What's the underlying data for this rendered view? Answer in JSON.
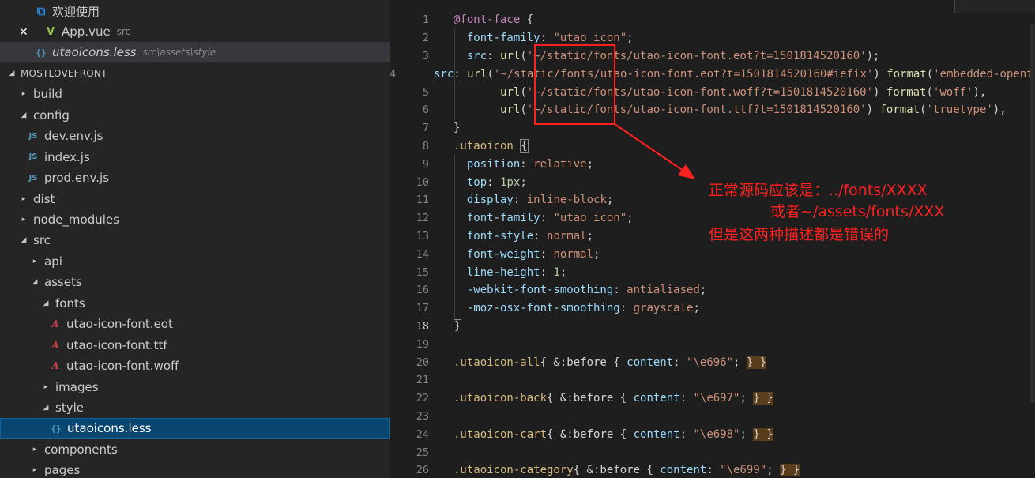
{
  "open_editors": [
    {
      "icon": "vscode-icon",
      "label": "欢迎使用",
      "description": "",
      "italic": false
    },
    {
      "icon": "vue-icon",
      "label": "App.vue",
      "description": "src",
      "italic": false,
      "dirty": true
    },
    {
      "icon": "less-icon",
      "label": "utaoicons.less",
      "description": "src\\assets\\style",
      "italic": true
    }
  ],
  "explorer": {
    "title": "MOSTLOVEFRONT",
    "items": [
      {
        "label": "build",
        "type": "folder",
        "expanded": false,
        "depth": 0
      },
      {
        "label": "config",
        "type": "folder",
        "expanded": true,
        "depth": 0
      },
      {
        "label": "dev.env.js",
        "type": "js",
        "depth": 1
      },
      {
        "label": "index.js",
        "type": "js",
        "depth": 1
      },
      {
        "label": "prod.env.js",
        "type": "js",
        "depth": 1
      },
      {
        "label": "dist",
        "type": "folder",
        "expanded": false,
        "depth": 0
      },
      {
        "label": "node_modules",
        "type": "folder",
        "expanded": false,
        "depth": 0
      },
      {
        "label": "src",
        "type": "folder",
        "expanded": true,
        "depth": 0
      },
      {
        "label": "api",
        "type": "folder",
        "expanded": false,
        "depth": 1
      },
      {
        "label": "assets",
        "type": "folder",
        "expanded": true,
        "depth": 1
      },
      {
        "label": "fonts",
        "type": "folder",
        "expanded": true,
        "depth": 2
      },
      {
        "label": "utao-icon-font.eot",
        "type": "font",
        "depth": 3
      },
      {
        "label": "utao-icon-font.ttf",
        "type": "font",
        "depth": 3
      },
      {
        "label": "utao-icon-font.woff",
        "type": "font",
        "depth": 3
      },
      {
        "label": "images",
        "type": "folder",
        "expanded": false,
        "depth": 2
      },
      {
        "label": "style",
        "type": "folder",
        "expanded": true,
        "depth": 2
      },
      {
        "label": "utaoicons.less",
        "type": "less",
        "depth": 3,
        "selected": true
      },
      {
        "label": "components",
        "type": "folder",
        "expanded": false,
        "depth": 1
      },
      {
        "label": "pages",
        "type": "folder",
        "expanded": false,
        "depth": 1
      }
    ]
  },
  "icons": {
    "twistie_collapsed": "▸",
    "twistie_expanded": "◢",
    "js": "JS",
    "font": "A",
    "less": "{}",
    "vue": "V",
    "close": "✕"
  },
  "editor": {
    "line_numbers": [
      "1",
      "2",
      "3",
      "4",
      "5",
      "6",
      "7",
      "8",
      "9",
      "10",
      "11",
      "12",
      "13",
      "14",
      "15",
      "16",
      "17",
      "18",
      "19",
      "20",
      "21",
      "22",
      "23",
      "24",
      "25",
      "26"
    ],
    "current_line": "18",
    "lines": [
      [
        [
          "t-at",
          "@font-face"
        ],
        [
          "code",
          " {"
        ]
      ],
      [
        [
          "code",
          "  "
        ],
        [
          "t-prop",
          "font-family"
        ],
        [
          "code",
          ": "
        ],
        [
          "t-str",
          "\"utao icon\""
        ],
        [
          "code",
          ";"
        ]
      ],
      [
        [
          "code",
          "  "
        ],
        [
          "t-prop",
          "src"
        ],
        [
          "code",
          ": "
        ],
        [
          "t-fn",
          "url"
        ],
        [
          "code",
          "("
        ],
        [
          "t-str",
          "'~/static/fonts/utao-icon-font.eot?t=1501814520160'"
        ],
        [
          "code",
          ");"
        ]
      ],
      [
        [
          "code",
          "  "
        ],
        [
          "t-prop",
          "src"
        ],
        [
          "code",
          ": "
        ],
        [
          "t-fn",
          "url"
        ],
        [
          "code",
          "("
        ],
        [
          "t-str",
          "'~/static/fonts/utao-icon-font.eot?t=1501814520160#iefix'"
        ],
        [
          "code",
          ") "
        ],
        [
          "t-fn",
          "format"
        ],
        [
          "code",
          "("
        ],
        [
          "t-str",
          "'embedded-opentype'"
        ],
        [
          "code",
          "),"
        ]
      ],
      [
        [
          "code",
          "       "
        ],
        [
          "t-fn",
          "url"
        ],
        [
          "code",
          "("
        ],
        [
          "t-str",
          "'~/static/fonts/utao-icon-font.woff?t=1501814520160'"
        ],
        [
          "code",
          ") "
        ],
        [
          "t-fn",
          "format"
        ],
        [
          "code",
          "("
        ],
        [
          "t-str",
          "'woff'"
        ],
        [
          "code",
          "),"
        ]
      ],
      [
        [
          "code",
          "       "
        ],
        [
          "t-fn",
          "url"
        ],
        [
          "code",
          "("
        ],
        [
          "t-str",
          "'~/static/fonts/utao-icon-font.ttf?t=1501814520160'"
        ],
        [
          "code",
          ") "
        ],
        [
          "t-fn",
          "format"
        ],
        [
          "code",
          "("
        ],
        [
          "t-str",
          "'truetype'"
        ],
        [
          "code",
          "),"
        ]
      ],
      [
        [
          "code",
          "}"
        ]
      ],
      [
        [
          "t-sel",
          ".utaoicon"
        ],
        [
          "code",
          " "
        ],
        [
          "t-brk2",
          "{"
        ]
      ],
      [
        [
          "code",
          "  "
        ],
        [
          "t-prop",
          "position"
        ],
        [
          "code",
          ": "
        ],
        [
          "t-str",
          "relative"
        ],
        [
          "code",
          ";"
        ]
      ],
      [
        [
          "code",
          "  "
        ],
        [
          "t-prop",
          "top"
        ],
        [
          "code",
          ": "
        ],
        [
          "t-num",
          "1px"
        ],
        [
          "code",
          ";"
        ]
      ],
      [
        [
          "code",
          "  "
        ],
        [
          "t-prop",
          "display"
        ],
        [
          "code",
          ": "
        ],
        [
          "t-str",
          "inline-block"
        ],
        [
          "code",
          ";"
        ]
      ],
      [
        [
          "code",
          "  "
        ],
        [
          "t-prop",
          "font-family"
        ],
        [
          "code",
          ": "
        ],
        [
          "t-str",
          "\"utao icon\""
        ],
        [
          "code",
          ";"
        ]
      ],
      [
        [
          "code",
          "  "
        ],
        [
          "t-prop",
          "font-style"
        ],
        [
          "code",
          ": "
        ],
        [
          "t-str",
          "normal"
        ],
        [
          "code",
          ";"
        ]
      ],
      [
        [
          "code",
          "  "
        ],
        [
          "t-prop",
          "font-weight"
        ],
        [
          "code",
          ": "
        ],
        [
          "t-str",
          "normal"
        ],
        [
          "code",
          ";"
        ]
      ],
      [
        [
          "code",
          "  "
        ],
        [
          "t-prop",
          "line-height"
        ],
        [
          "code",
          ": "
        ],
        [
          "t-num",
          "1"
        ],
        [
          "code",
          ";"
        ]
      ],
      [
        [
          "code",
          "  "
        ],
        [
          "t-prop",
          "-webkit-font-smoothing"
        ],
        [
          "code",
          ": "
        ],
        [
          "t-str",
          "antialiased"
        ],
        [
          "code",
          ";"
        ]
      ],
      [
        [
          "code",
          "  "
        ],
        [
          "t-prop",
          "-moz-osx-font-smoothing"
        ],
        [
          "code",
          ": "
        ],
        [
          "t-str",
          "grayscale"
        ],
        [
          "code",
          ";"
        ]
      ],
      [
        [
          "t-brk2",
          "}"
        ]
      ],
      [],
      [
        [
          "t-sel",
          ".utaoicon-all"
        ],
        [
          "code",
          "{ &:before { "
        ],
        [
          "t-prop",
          "content"
        ],
        [
          "code",
          ": "
        ],
        [
          "t-str",
          "\"\\e696\""
        ],
        [
          "code",
          "; "
        ],
        [
          "t-brk",
          "} }"
        ]
      ],
      [],
      [
        [
          "t-sel",
          ".utaoicon-back"
        ],
        [
          "code",
          "{ &:before { "
        ],
        [
          "t-prop",
          "content"
        ],
        [
          "code",
          ": "
        ],
        [
          "t-str",
          "\"\\e697\""
        ],
        [
          "code",
          "; "
        ],
        [
          "t-brk",
          "} }"
        ]
      ],
      [],
      [
        [
          "t-sel",
          ".utaoicon-cart"
        ],
        [
          "code",
          "{ &:before { "
        ],
        [
          "t-prop",
          "content"
        ],
        [
          "code",
          ": "
        ],
        [
          "t-str",
          "\"\\e698\""
        ],
        [
          "code",
          "; "
        ],
        [
          "t-brk",
          "} }"
        ]
      ],
      [],
      [
        [
          "t-sel",
          ".utaoicon-category"
        ],
        [
          "code",
          "{ &:before { "
        ],
        [
          "t-prop",
          "content"
        ],
        [
          "code",
          ": "
        ],
        [
          "t-str",
          "\"\\e699\""
        ],
        [
          "code",
          "; "
        ],
        [
          "t-brk",
          "} }"
        ]
      ]
    ]
  },
  "annotation": {
    "line1": "正常源码应该是：../fonts/XXXX",
    "line2": "或者~/assets/fonts/XXX",
    "line3": "但是这两种描述都是错误的",
    "color": "#ff2020"
  }
}
